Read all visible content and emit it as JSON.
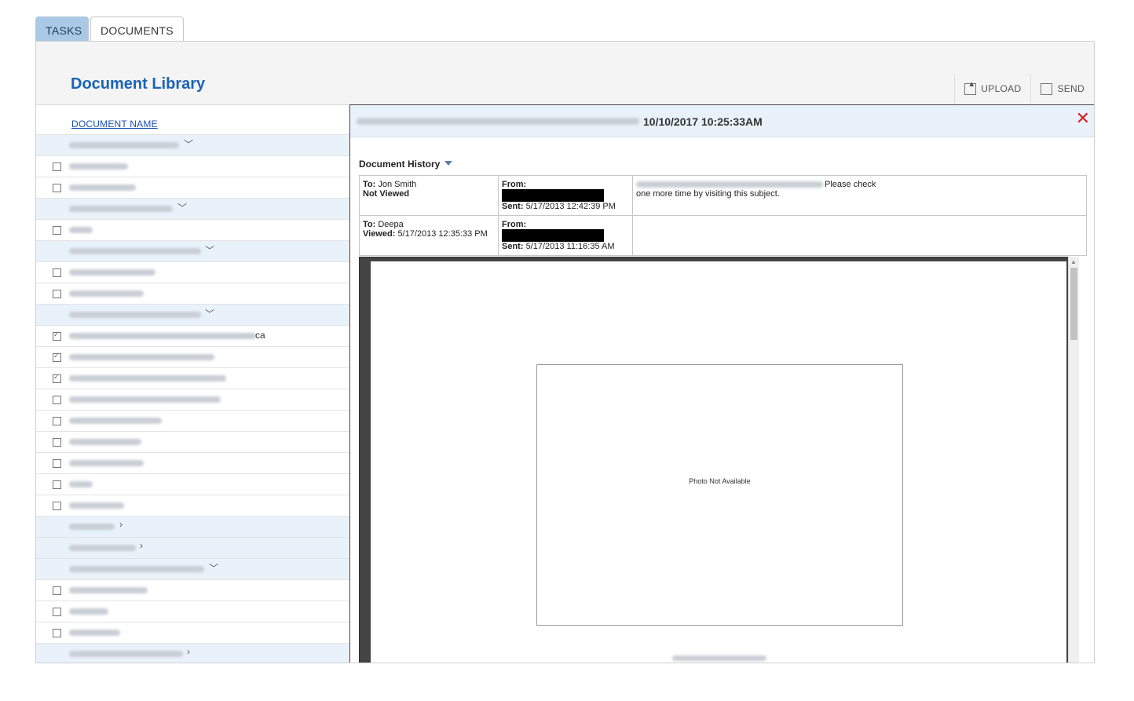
{
  "tabs": [
    {
      "label": "TASKS"
    },
    {
      "label": "DOCUMENTS"
    }
  ],
  "library": {
    "title": "Document Library",
    "upload_label": "UPLOAD",
    "send_label": "SEND",
    "column_header": "DOCUMENT NAME",
    "partial_suffix": "ca"
  },
  "viewer": {
    "timestamp": "10/10/2017 10:25:33AM",
    "history_title": "Document History",
    "rows": [
      {
        "to_label": "To:",
        "to_value": "Jon Smith",
        "status": "Not Viewed",
        "status_time": "",
        "from_label": "From:",
        "sent_label": "Sent:",
        "sent_value": "5/17/2013 12:42:39 PM",
        "message_tail": "Please check",
        "message_line2": "one more time by visiting this subject."
      },
      {
        "to_label": "To:",
        "to_value": "Deepa",
        "status": "Viewed:",
        "status_time": "5/17/2013 12:35:33 PM",
        "from_label": "From:",
        "sent_label": "Sent:",
        "sent_value": "5/17/2013 11:16:35 AM",
        "message_tail": "",
        "message_line2": ""
      }
    ],
    "photo_placeholder": "Photo Not Available"
  },
  "colors": {
    "title_blue": "#1a63b8",
    "category_bg": "#e9f2fb",
    "close_red": "#d61e1e"
  }
}
